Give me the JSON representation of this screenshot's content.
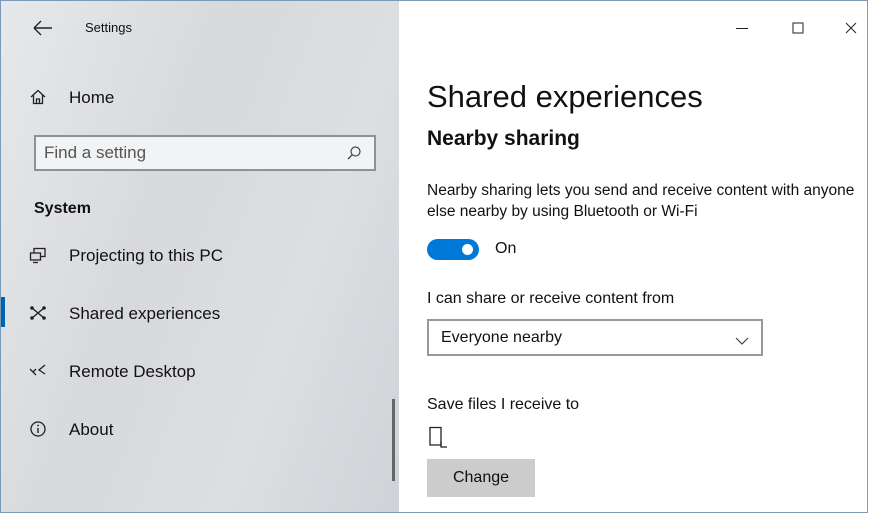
{
  "window": {
    "app_title": "Settings",
    "controls": {
      "minimize": "minimize",
      "maximize": "maximize",
      "close": "close"
    }
  },
  "sidebar": {
    "home": {
      "label": "Home",
      "icon": "home-icon"
    },
    "search": {
      "placeholder": "Find a setting",
      "value": "",
      "icon": "search-icon"
    },
    "section_heading": "System",
    "items": [
      {
        "label": "Projecting to this PC",
        "icon": "projecting-icon",
        "selected": false
      },
      {
        "label": "Shared experiences",
        "icon": "shared-experiences-icon",
        "selected": true
      },
      {
        "label": "Remote Desktop",
        "icon": "remote-desktop-icon",
        "selected": false
      },
      {
        "label": "About",
        "icon": "info-icon",
        "selected": false
      }
    ]
  },
  "main": {
    "title": "Shared experiences",
    "subtitle": "Nearby sharing",
    "description": "Nearby sharing lets you send and receive content with anyone else nearby by using Bluetooth or Wi-Fi",
    "toggle": {
      "state": "On",
      "on": true
    },
    "share_from": {
      "label": "I can share or receive content from",
      "selected": "Everyone nearby"
    },
    "save_to": {
      "label": "Save files I receive to",
      "button_label": "Change"
    }
  },
  "colors": {
    "accent": "#0078d7",
    "selection_bar": "#0063b1",
    "sidebar_bg": "#dcdee2",
    "button_bg": "#cccccc"
  }
}
